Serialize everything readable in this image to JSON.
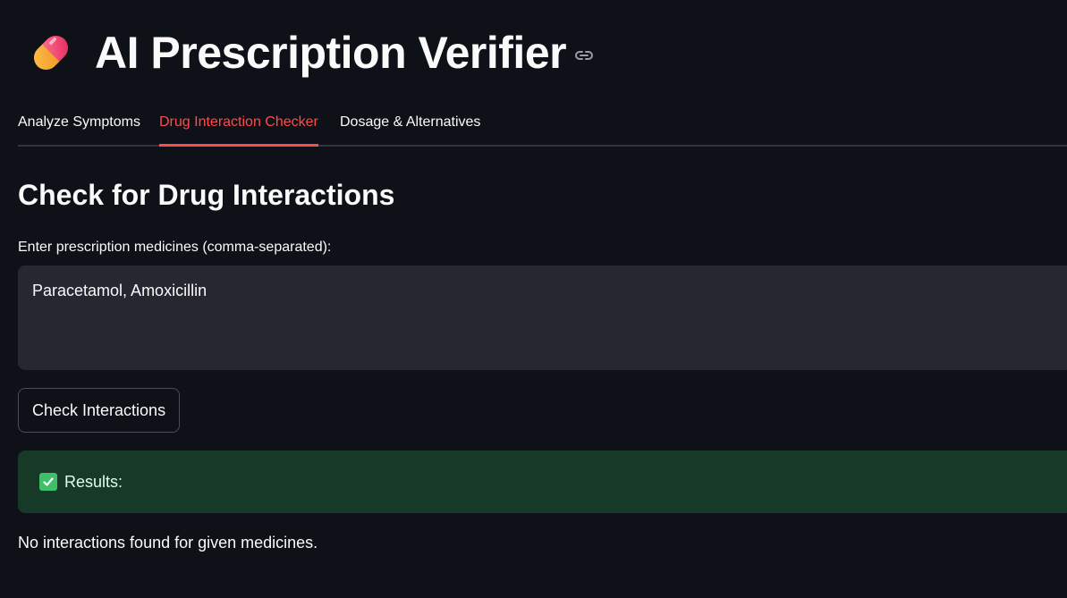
{
  "header": {
    "title": "AI Prescription Verifier",
    "pill_icon": "pill-icon",
    "anchor_icon": "link-icon"
  },
  "tabs": [
    {
      "label": "Analyze Symptoms",
      "active": false
    },
    {
      "label": "Drug Interaction Checker",
      "active": true
    },
    {
      "label": "Dosage & Alternatives",
      "active": false
    }
  ],
  "main": {
    "heading": "Check for Drug Interactions",
    "input_label": "Enter prescription medicines (comma-separated):",
    "input_value": "Paracetamol, Amoxicillin",
    "button_label": "Check Interactions",
    "alert_icon": "check-box-icon",
    "alert_text": "Results:",
    "result_text": "No interactions found for given medicines."
  },
  "colors": {
    "background": "#0e1117",
    "accent": "#ff4b4b",
    "input_bg": "#262730",
    "success_bg": "#173928"
  }
}
